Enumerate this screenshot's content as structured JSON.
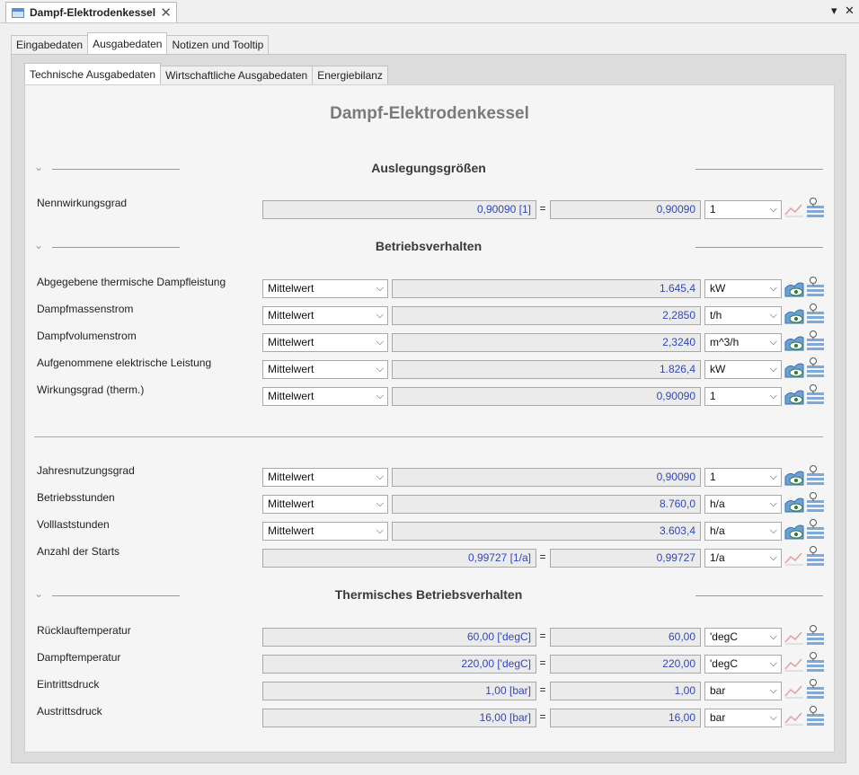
{
  "window": {
    "tab_title": "Dampf-Elektrodenkessel",
    "close_glyph": "✕",
    "pin_glyph": "▾",
    "win_close_glyph": "✕"
  },
  "tabs": [
    "Eingabedaten",
    "Ausgabedaten",
    "Notizen und Tooltip"
  ],
  "subtabs": [
    "Technische Ausgabedaten",
    "Wirtschaftliche Ausgabedaten",
    "Energiebilanz"
  ],
  "main_title": "Dampf-Elektrodenkessel",
  "sections": {
    "auslegung": "Auslegungsgrößen",
    "betrieb": "Betriebsverhalten",
    "thermisch": "Thermisches Betriebsverhalten"
  },
  "collapse_glyph": "⌄",
  "equals": "=",
  "caret": "⌵",
  "rows": {
    "nennwirkungsgrad": {
      "label": "Nennwirkungsgrad",
      "raw": "0,90090 [1]",
      "value": "0,90090",
      "unit": "1"
    },
    "dampfleistung": {
      "label": "Abgegebene thermische Dampfleistung",
      "mode": "Mittelwert",
      "value": "1.645,4",
      "unit": "kW"
    },
    "massenstrom": {
      "label": "Dampfmassenstrom",
      "mode": "Mittelwert",
      "value": "2,2850",
      "unit": "t/h"
    },
    "volumenstrom": {
      "label": "Dampfvolumenstrom",
      "mode": "Mittelwert",
      "value": "2,3240",
      "unit": "m^3/h"
    },
    "el_leistung": {
      "label": "Aufgenommene elektrische Leistung",
      "mode": "Mittelwert",
      "value": "1.826,4",
      "unit": "kW"
    },
    "wirkungsgrad": {
      "label": "Wirkungsgrad (therm.)",
      "mode": "Mittelwert",
      "value": "0,90090",
      "unit": "1"
    },
    "jahresnutzung": {
      "label": "Jahresnutzungsgrad",
      "mode": "Mittelwert",
      "value": "0,90090",
      "unit": "1"
    },
    "betriebsstunden": {
      "label": "Betriebsstunden",
      "mode": "Mittelwert",
      "value": "8.760,0",
      "unit": "h/a"
    },
    "volllaststunden": {
      "label": "Volllaststunden",
      "mode": "Mittelwert",
      "value": "3.603,4",
      "unit": "h/a"
    },
    "starts": {
      "label": "Anzahl der Starts",
      "raw": "0,99727 [1/a]",
      "value": "0,99727",
      "unit": "1/a"
    },
    "ruecklauf": {
      "label": "Rücklauftemperatur",
      "raw": "60,00 ['degC]",
      "value": "60,00",
      "unit": "'degC"
    },
    "dampftemp": {
      "label": "Dampftemperatur",
      "raw": "220,00 ['degC]",
      "value": "220,00",
      "unit": "'degC"
    },
    "eintritt": {
      "label": "Eintrittsdruck",
      "raw": "1,00 [bar]",
      "value": "1,00",
      "unit": "bar"
    },
    "austritt": {
      "label": "Austrittsdruck",
      "raw": "16,00 [bar]",
      "value": "16,00",
      "unit": "bar"
    }
  },
  "icons": {
    "chart_active": "chart-eye-icon",
    "chart_inactive": "chart-disabled-icon",
    "list": "list-pin-icon"
  },
  "colors": {
    "value_text": "#3347b0",
    "title": "#7a7a7a"
  }
}
